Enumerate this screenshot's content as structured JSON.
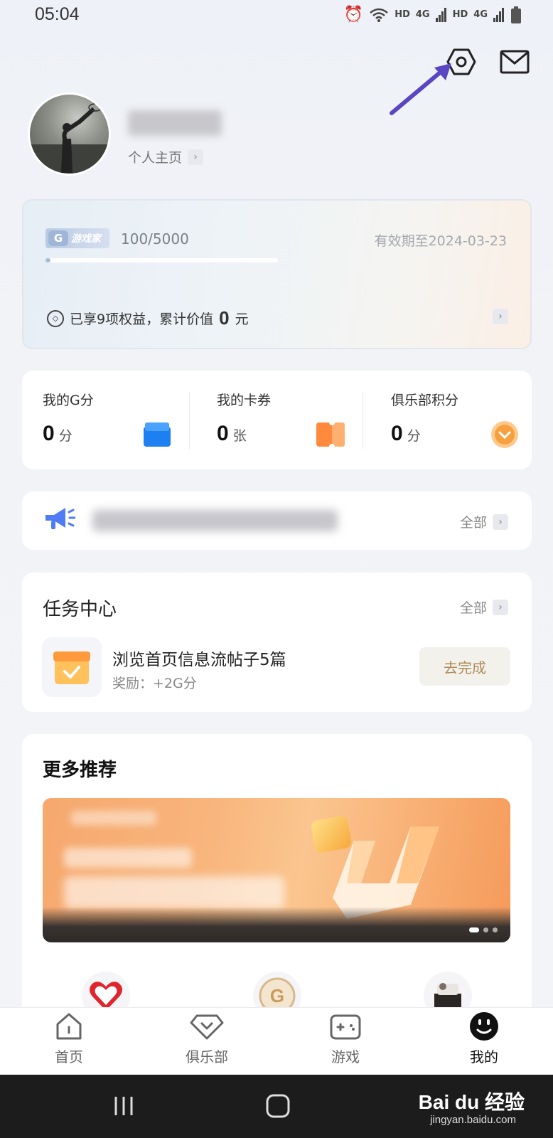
{
  "status_bar": {
    "time": "05:04",
    "hd1": "HD",
    "net1": "4G",
    "hd2": "HD",
    "net2": "4G"
  },
  "header": {
    "settings_icon": "hexagon-settings-icon",
    "mail_icon": "mail-icon",
    "annotation_arrow_color": "#5a45c2"
  },
  "profile": {
    "link_label": "个人主页"
  },
  "membership": {
    "badge_label": "游戏家",
    "points": "100/5000",
    "progress_fraction": 0.02,
    "expiry": "有效期至2024-03-23",
    "benefits_prefix": "已享9项权益，累计价值",
    "benefits_value": "0",
    "benefits_unit": "元"
  },
  "stats": [
    {
      "label": "我的G分",
      "value": "0",
      "unit": "分",
      "icon": "blue-box-icon"
    },
    {
      "label": "我的卡券",
      "value": "0",
      "unit": "张",
      "icon": "orange-ticket-icon"
    },
    {
      "label": "俱乐部积分",
      "value": "0",
      "unit": "分",
      "icon": "orange-badge-icon"
    }
  ],
  "notice": {
    "icon": "megaphone-icon",
    "all_label": "全部"
  },
  "task_center": {
    "title": "任务中心",
    "all_label": "全部",
    "task_name": "浏览首页信息流帖子5篇",
    "task_reward": "奖励：+2G分",
    "task_button": "去完成"
  },
  "recommend": {
    "title": "更多推荐"
  },
  "tabbar": [
    {
      "label": "首页",
      "icon": "home-icon"
    },
    {
      "label": "俱乐部",
      "icon": "diamond-icon"
    },
    {
      "label": "游戏",
      "icon": "gamepad-icon"
    },
    {
      "label": "我的",
      "icon": "smiley-icon",
      "active": true
    }
  ],
  "watermark": {
    "brand": "Bai du 经验",
    "url": "jingyan.baidu.com"
  },
  "colors": {
    "accent_orange": "#f7a040",
    "task_button_text": "#b08a57",
    "blue_icon": "#1e7ff0"
  }
}
